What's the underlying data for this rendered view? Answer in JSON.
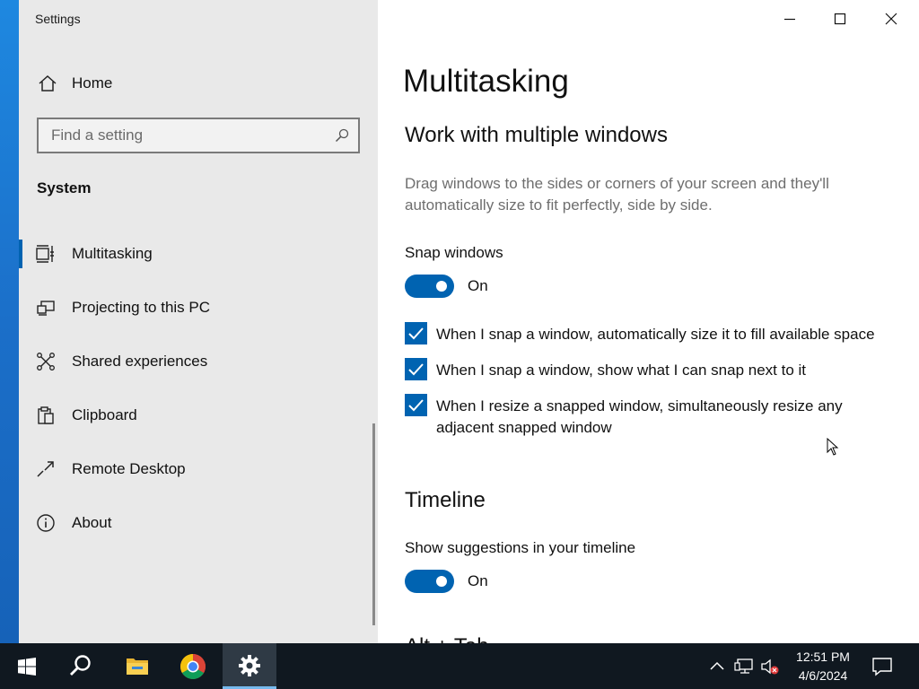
{
  "window": {
    "title": "Settings"
  },
  "sidebar": {
    "home_label": "Home",
    "search": {
      "placeholder": "Find a setting",
      "value": ""
    },
    "section_label": "System",
    "items": [
      {
        "label": "Multitasking",
        "icon": "multitasking-icon",
        "active": true
      },
      {
        "label": "Projecting to this PC",
        "icon": "projecting-icon",
        "active": false
      },
      {
        "label": "Shared experiences",
        "icon": "shared-experiences-icon",
        "active": false
      },
      {
        "label": "Clipboard",
        "icon": "clipboard-icon",
        "active": false
      },
      {
        "label": "Remote Desktop",
        "icon": "remote-desktop-icon",
        "active": false
      },
      {
        "label": "About",
        "icon": "info-icon",
        "active": false
      }
    ]
  },
  "main": {
    "page_title": "Multitasking",
    "section1": {
      "heading": "Work with multiple windows",
      "description": "Drag windows to the sides or corners of your screen and they'll automatically size to fit perfectly, side by side.",
      "snap_label": "Snap windows",
      "snap_toggle": {
        "state": "On",
        "on": true
      },
      "checkboxes": [
        {
          "label": "When I snap a window, automatically size it to fill available space",
          "checked": true
        },
        {
          "label": "When I snap a window, show what I can snap next to it",
          "checked": true
        },
        {
          "label": "When I resize a snapped window, simultaneously resize any adjacent snapped window",
          "checked": true
        }
      ]
    },
    "section2": {
      "heading": "Timeline",
      "suggestions_label": "Show suggestions in your timeline",
      "suggestions_toggle": {
        "state": "On",
        "on": true
      }
    },
    "next_heading_partial": "Alt + Tab"
  },
  "taskbar": {
    "apps": [
      {
        "icon": "start-windows-icon"
      },
      {
        "icon": "search-icon"
      },
      {
        "icon": "file-explorer-icon"
      },
      {
        "icon": "chrome-icon"
      },
      {
        "icon": "settings-gear-icon",
        "active": true
      }
    ],
    "tray": [
      "chevron-up-icon",
      "network-icon",
      "volume-muted-icon"
    ],
    "clock": {
      "time": "12:51 PM",
      "date": "4/6/2024"
    }
  },
  "colors": {
    "accent": "#0063b1",
    "sidebar_bg": "#e9e9e9",
    "taskbar_bg": "#101820"
  }
}
